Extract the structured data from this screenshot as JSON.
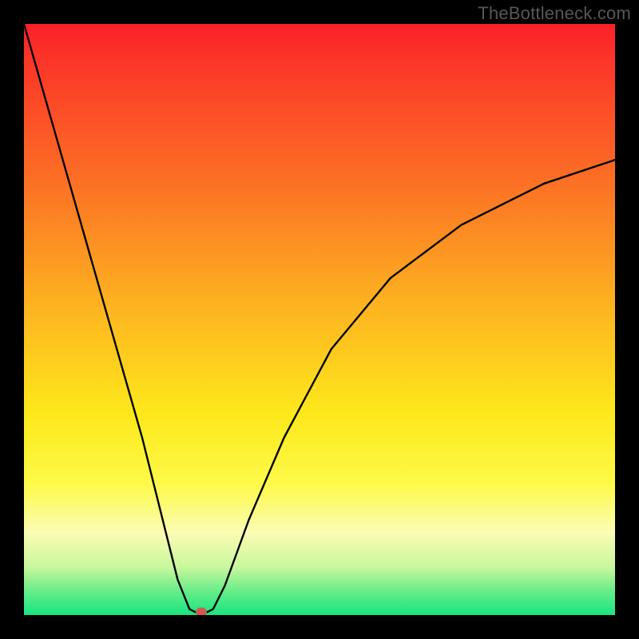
{
  "watermark": "TheBottleneck.com",
  "chart_data": {
    "type": "line",
    "title": "",
    "xlabel": "",
    "ylabel": "",
    "xlim": [
      0,
      100
    ],
    "ylim": [
      0,
      100
    ],
    "grid": false,
    "legend": false,
    "series": [
      {
        "name": "bottleneck-curve",
        "x": [
          0,
          4,
          8,
          12,
          16,
          20,
          24,
          26,
          28,
          29,
          30,
          31,
          32,
          34,
          38,
          44,
          52,
          62,
          74,
          88,
          100
        ],
        "y": [
          100,
          86,
          72,
          58,
          44,
          30,
          14,
          6,
          1,
          0.5,
          0.4,
          0.5,
          1,
          5,
          16,
          30,
          45,
          57,
          66,
          73,
          77
        ]
      }
    ],
    "annotations": [
      {
        "name": "optimal-marker",
        "x": 30,
        "y": 0.5,
        "color": "#d15a4d"
      }
    ],
    "background_gradient": {
      "top": "#fb2029",
      "mid": "#fde81b",
      "bottom": "#17e580"
    }
  }
}
